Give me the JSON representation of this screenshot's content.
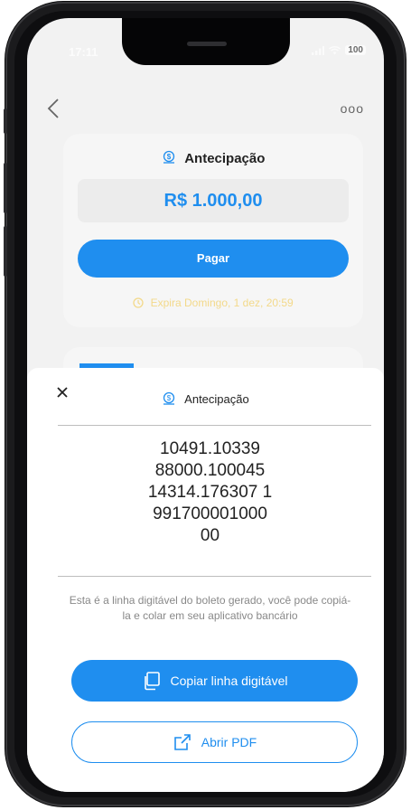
{
  "status": {
    "time": "17:11",
    "battery": "100"
  },
  "nav": {
    "back_icon": "chevron-left-icon",
    "more_label": "ooo"
  },
  "card": {
    "title": "Antecipação",
    "amount": "R$ 1.000,00",
    "pay_label": "Pagar",
    "expire_text": "Expira Domingo, 1 dez, 20:59"
  },
  "sheet": {
    "title": "Antecipação",
    "code_lines": [
      "10491.10339",
      "88000.100045",
      "14314.176307 1",
      "991700001000",
      "00"
    ],
    "info": "Esta é a linha digitável do boleto gerado, você pode copiá-la e colar em seu aplicativo bancário",
    "copy_label": "Copiar linha digitável",
    "pdf_label": "Abrir PDF"
  },
  "colors": {
    "accent": "#1f8eef",
    "warning": "#f3d98a"
  }
}
